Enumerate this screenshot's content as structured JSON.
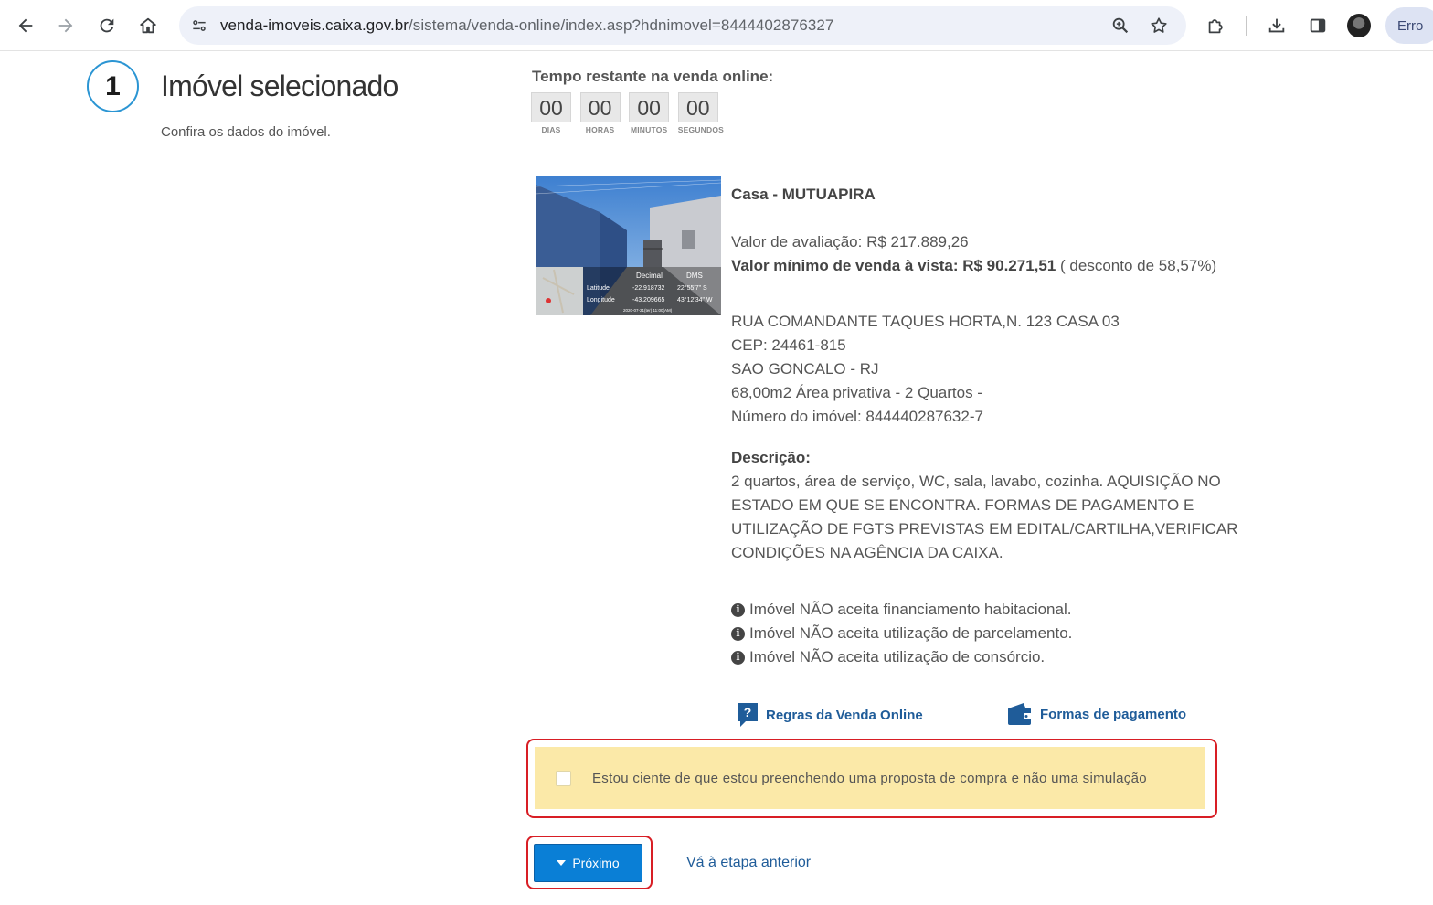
{
  "browser": {
    "url_domain": "venda-imoveis.caixa.gov.br",
    "url_path": "/sistema/venda-online/index.asp?hdnimovel=8444402876327",
    "profile_button": "Erro"
  },
  "step": {
    "number": "1",
    "title": "Imóvel selecionado",
    "subtitle": "Confira os dados do imóvel."
  },
  "timer": {
    "label": "Tempo restante na venda online:",
    "cells": [
      {
        "value": "00",
        "unit": "DIAS"
      },
      {
        "value": "00",
        "unit": "HORAS"
      },
      {
        "value": "00",
        "unit": "MINUTOS"
      },
      {
        "value": "00",
        "unit": "SEGUNDOS"
      }
    ]
  },
  "photo": {
    "overlay": {
      "col1": "Decimal",
      "col2": "DMS",
      "lat_label": "Latitude",
      "lat_dec": "-22.918732",
      "lat_dms": "22°55'7\" S",
      "lon_label": "Longitude",
      "lon_dec": "-43.209665",
      "lon_dms": "43°12'34\" W",
      "stamp": "2020-07-21(ter) 11:00(AM)"
    }
  },
  "property": {
    "title": "Casa - MUTUAPIRA",
    "valuation_label": "Valor de avaliação:",
    "valuation_value": "R$ 217.889,26",
    "min_label": "Valor mínimo de venda à vista:",
    "min_value": "R$ 90.271,51",
    "discount": "( desconto de 58,57%)",
    "address": "RUA COMANDANTE TAQUES HORTA,N. 123 CASA 03",
    "cep": "CEP: 24461-815",
    "city": "SAO GONCALO - RJ",
    "area": "68,00m2 Área privativa - 2 Quartos -",
    "number": "Número do imóvel: 844440287632-7",
    "desc_label": "Descrição:",
    "desc_lines": [
      "2 quartos, área de serviço, WC, sala, lavabo, cozinha. AQUISIÇÃO NO",
      "ESTADO EM QUE SE ENCONTRA. FORMAS DE PAGAMENTO E",
      "UTILIZAÇÃO DE FGTS PREVISTAS EM EDITAL/CARTILHA,VERIFICAR",
      "CONDIÇÕES NA AGÊNCIA DA CAIXA."
    ],
    "info": [
      "Imóvel NÃO aceita financiamento habitacional.",
      "Imóvel NÃO aceita utilização de parcelamento.",
      "Imóvel NÃO aceita utilização de consórcio."
    ]
  },
  "links": {
    "regras": "Regras da Venda Online",
    "formas": "Formas de pagamento"
  },
  "notice": {
    "text": "Estou ciente de que estou preenchendo uma proposta de compra e não uma simulação",
    "checked": false
  },
  "actions": {
    "next": "Próximo",
    "previous": "Vá à etapa anterior"
  },
  "colors": {
    "accent": "#0a7fd6",
    "link": "#1f5c99",
    "notice_bg": "#fbe9a8",
    "highlight": "#d81e25",
    "step_ring": "#2b95d3"
  }
}
